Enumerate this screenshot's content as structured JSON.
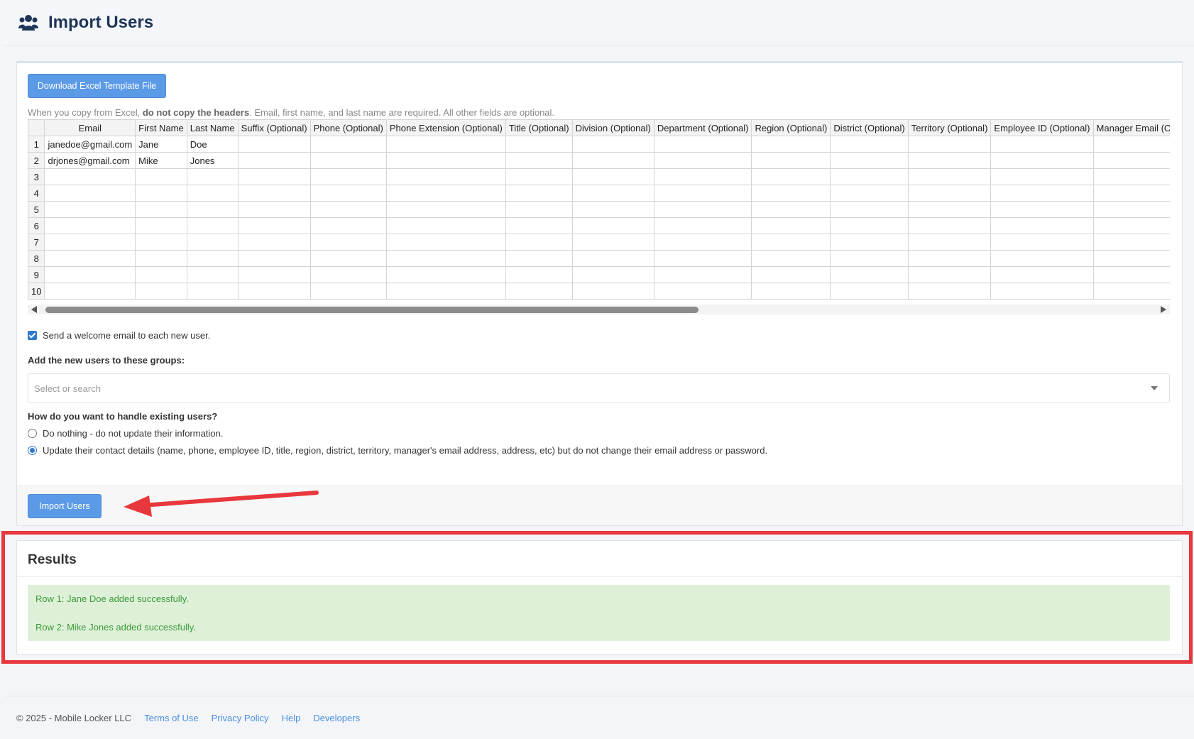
{
  "header": {
    "title": "Import Users",
    "icon": "users-icon"
  },
  "download_button": "Download Excel Template File",
  "hint": {
    "prefix": "When you copy from Excel, ",
    "bold": "do not copy the headers",
    "suffix": ". Email, first name, and last name are required. All other fields are optional."
  },
  "grid": {
    "columns": [
      "Email",
      "First Name",
      "Last Name",
      "Suffix (Optional)",
      "Phone (Optional)",
      "Phone Extension (Optional)",
      "Title (Optional)",
      "Division (Optional)",
      "Department (Optional)",
      "Region (Optional)",
      "District (Optional)",
      "Territory (Optional)",
      "Employee ID (Optional)",
      "Manager Email (Optional)"
    ],
    "rows": [
      {
        "n": "1",
        "cells": [
          "janedoe@gmail.com",
          "Jane",
          "Doe"
        ]
      },
      {
        "n": "2",
        "cells": [
          "drjones@gmail.com",
          "Mike",
          "Jones"
        ]
      },
      {
        "n": "3",
        "cells": []
      },
      {
        "n": "4",
        "cells": []
      },
      {
        "n": "5",
        "cells": []
      },
      {
        "n": "6",
        "cells": []
      },
      {
        "n": "7",
        "cells": []
      },
      {
        "n": "8",
        "cells": []
      },
      {
        "n": "9",
        "cells": []
      },
      {
        "n": "10",
        "cells": []
      }
    ]
  },
  "welcome_email": {
    "label": "Send a welcome email to each new user.",
    "checked": true
  },
  "groups": {
    "label": "Add the new users to these groups:",
    "placeholder": "Select or search"
  },
  "existing_users": {
    "label": "How do you want to handle existing users?",
    "options": [
      {
        "label": "Do nothing - do not update their information.",
        "selected": false
      },
      {
        "label": "Update their contact details (name, phone, employee ID, title, region, district, territory, manager's email address, address, etc) but do not change their email address or password.",
        "selected": true
      }
    ]
  },
  "import_button": "Import Users",
  "results": {
    "title": "Results",
    "messages": [
      "Row 1: Jane Doe added successfully.",
      "Row 2: Mike Jones added successfully."
    ]
  },
  "footer": {
    "copyright": "© 2025 - Mobile Locker LLC",
    "links": [
      "Terms of Use",
      "Privacy Policy",
      "Help",
      "Developers"
    ]
  },
  "colors": {
    "accent": "#5b9ae6",
    "success_bg": "#dff0d8",
    "success_text": "#3a9b3a",
    "highlight": "#e8373d"
  }
}
